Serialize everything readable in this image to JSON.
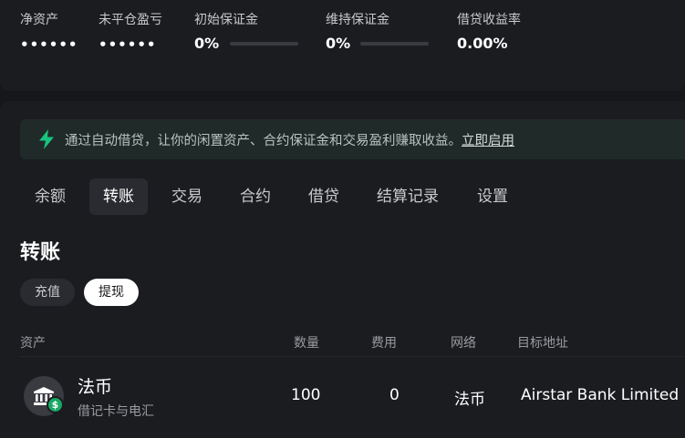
{
  "stats": {
    "net_assets": {
      "label": "净资产",
      "value": "••••••"
    },
    "unrealized_pnl": {
      "label": "未平仓盈亏",
      "value": "••••••"
    },
    "initial_margin": {
      "label": "初始保证金",
      "value": "0%",
      "progress": 0
    },
    "maintenance_margin": {
      "label": "维持保证金",
      "value": "0%",
      "progress": 0
    },
    "lending_yield": {
      "label": "借贷收益率",
      "value": "0.00%"
    }
  },
  "banner": {
    "icon": "lightning-bolt-icon",
    "text": "通过自动借贷，让你的闲置资产、合约保证金和交易盈利赚取收益。",
    "link": "立即启用",
    "accent": "#19c37d"
  },
  "tabs": [
    {
      "label": "余额",
      "active": false
    },
    {
      "label": "转账",
      "active": true
    },
    {
      "label": "交易",
      "active": false
    },
    {
      "label": "合约",
      "active": false
    },
    {
      "label": "借贷",
      "active": false
    },
    {
      "label": "结算记录",
      "active": false
    },
    {
      "label": "设置",
      "active": false
    }
  ],
  "section": {
    "title": "转账",
    "pills": {
      "deposit": "充值",
      "withdraw": "提现"
    },
    "active_pill": "提现"
  },
  "table": {
    "headers": {
      "asset": "资产",
      "quantity": "数量",
      "fee": "费用",
      "network": "网络",
      "address": "目标地址"
    },
    "rows": [
      {
        "icon": "bank-icon",
        "badge": "$",
        "name": "法币",
        "subtitle": "借记卡与电汇",
        "quantity": "100",
        "fee": "0",
        "network": "法币",
        "address": "Airstar Bank Limited"
      }
    ]
  }
}
